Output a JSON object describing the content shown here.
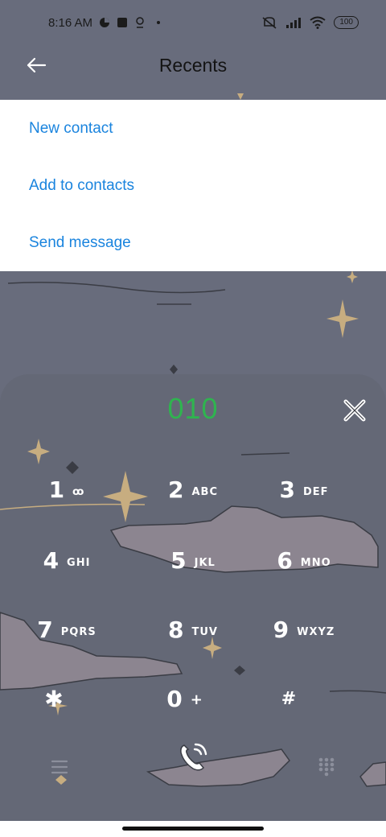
{
  "status_bar": {
    "time": "8:16 AM",
    "battery": "100",
    "icons": [
      "data-saver-icon",
      "square-icon",
      "location-icon",
      "muted-icon",
      "signal-icon",
      "wifi-icon"
    ]
  },
  "header": {
    "title": "Recents",
    "back_icon": "arrow-left-icon"
  },
  "menu": {
    "items": [
      {
        "label": "New contact"
      },
      {
        "label": "Add to contacts"
      },
      {
        "label": "Send message"
      }
    ]
  },
  "dialpad": {
    "number": "010",
    "keys": [
      {
        "digit": "1",
        "letters": "ꝏ"
      },
      {
        "digit": "2",
        "letters": "ABC"
      },
      {
        "digit": "3",
        "letters": "DEF"
      },
      {
        "digit": "4",
        "letters": "GHI"
      },
      {
        "digit": "5",
        "letters": "JKL"
      },
      {
        "digit": "6",
        "letters": "MNO"
      },
      {
        "digit": "7",
        "letters": "PQRS"
      },
      {
        "digit": "8",
        "letters": "TUV"
      },
      {
        "digit": "9",
        "letters": "WXYZ"
      },
      {
        "digit": "✱",
        "letters": ""
      },
      {
        "digit": "0",
        "letters": "+"
      },
      {
        "digit": "#",
        "letters": ""
      }
    ],
    "bottom_icons": [
      "menu-icon",
      "phone-call-icon",
      "dialpad-icon"
    ]
  },
  "colors": {
    "accent": "#1a84de",
    "number": "#2fb44f",
    "background": "#686c7c",
    "cloud": "#8c8590",
    "star": "#c7ad80"
  }
}
